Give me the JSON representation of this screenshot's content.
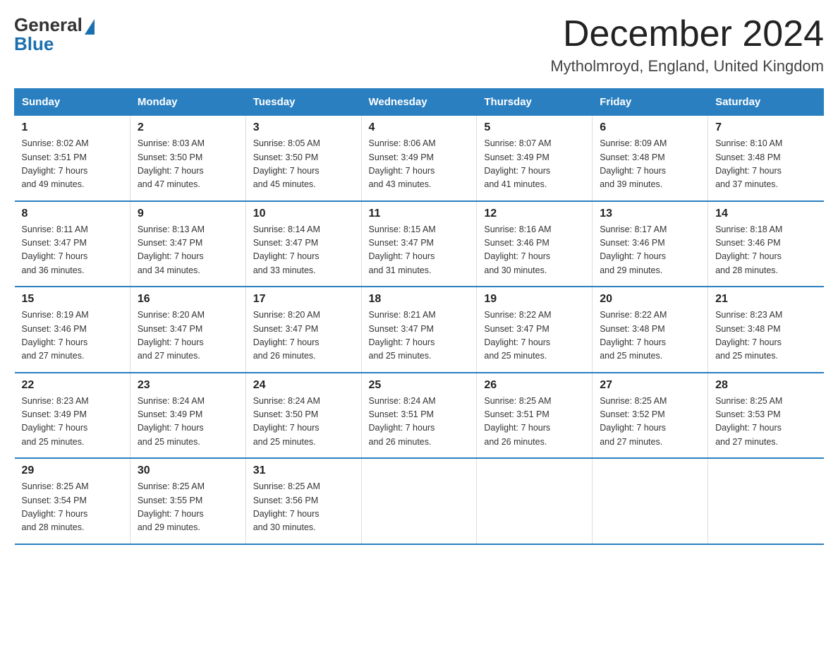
{
  "header": {
    "logo_general": "General",
    "logo_blue": "Blue",
    "month_title": "December 2024",
    "location": "Mytholmroyd, England, United Kingdom"
  },
  "days_of_week": [
    "Sunday",
    "Monday",
    "Tuesday",
    "Wednesday",
    "Thursday",
    "Friday",
    "Saturday"
  ],
  "weeks": [
    [
      {
        "day": "1",
        "sunrise": "8:02 AM",
        "sunset": "3:51 PM",
        "daylight": "7 hours and 49 minutes."
      },
      {
        "day": "2",
        "sunrise": "8:03 AM",
        "sunset": "3:50 PM",
        "daylight": "7 hours and 47 minutes."
      },
      {
        "day": "3",
        "sunrise": "8:05 AM",
        "sunset": "3:50 PM",
        "daylight": "7 hours and 45 minutes."
      },
      {
        "day": "4",
        "sunrise": "8:06 AM",
        "sunset": "3:49 PM",
        "daylight": "7 hours and 43 minutes."
      },
      {
        "day": "5",
        "sunrise": "8:07 AM",
        "sunset": "3:49 PM",
        "daylight": "7 hours and 41 minutes."
      },
      {
        "day": "6",
        "sunrise": "8:09 AM",
        "sunset": "3:48 PM",
        "daylight": "7 hours and 39 minutes."
      },
      {
        "day": "7",
        "sunrise": "8:10 AM",
        "sunset": "3:48 PM",
        "daylight": "7 hours and 37 minutes."
      }
    ],
    [
      {
        "day": "8",
        "sunrise": "8:11 AM",
        "sunset": "3:47 PM",
        "daylight": "7 hours and 36 minutes."
      },
      {
        "day": "9",
        "sunrise": "8:13 AM",
        "sunset": "3:47 PM",
        "daylight": "7 hours and 34 minutes."
      },
      {
        "day": "10",
        "sunrise": "8:14 AM",
        "sunset": "3:47 PM",
        "daylight": "7 hours and 33 minutes."
      },
      {
        "day": "11",
        "sunrise": "8:15 AM",
        "sunset": "3:47 PM",
        "daylight": "7 hours and 31 minutes."
      },
      {
        "day": "12",
        "sunrise": "8:16 AM",
        "sunset": "3:46 PM",
        "daylight": "7 hours and 30 minutes."
      },
      {
        "day": "13",
        "sunrise": "8:17 AM",
        "sunset": "3:46 PM",
        "daylight": "7 hours and 29 minutes."
      },
      {
        "day": "14",
        "sunrise": "8:18 AM",
        "sunset": "3:46 PM",
        "daylight": "7 hours and 28 minutes."
      }
    ],
    [
      {
        "day": "15",
        "sunrise": "8:19 AM",
        "sunset": "3:46 PM",
        "daylight": "7 hours and 27 minutes."
      },
      {
        "day": "16",
        "sunrise": "8:20 AM",
        "sunset": "3:47 PM",
        "daylight": "7 hours and 27 minutes."
      },
      {
        "day": "17",
        "sunrise": "8:20 AM",
        "sunset": "3:47 PM",
        "daylight": "7 hours and 26 minutes."
      },
      {
        "day": "18",
        "sunrise": "8:21 AM",
        "sunset": "3:47 PM",
        "daylight": "7 hours and 25 minutes."
      },
      {
        "day": "19",
        "sunrise": "8:22 AM",
        "sunset": "3:47 PM",
        "daylight": "7 hours and 25 minutes."
      },
      {
        "day": "20",
        "sunrise": "8:22 AM",
        "sunset": "3:48 PM",
        "daylight": "7 hours and 25 minutes."
      },
      {
        "day": "21",
        "sunrise": "8:23 AM",
        "sunset": "3:48 PM",
        "daylight": "7 hours and 25 minutes."
      }
    ],
    [
      {
        "day": "22",
        "sunrise": "8:23 AM",
        "sunset": "3:49 PM",
        "daylight": "7 hours and 25 minutes."
      },
      {
        "day": "23",
        "sunrise": "8:24 AM",
        "sunset": "3:49 PM",
        "daylight": "7 hours and 25 minutes."
      },
      {
        "day": "24",
        "sunrise": "8:24 AM",
        "sunset": "3:50 PM",
        "daylight": "7 hours and 25 minutes."
      },
      {
        "day": "25",
        "sunrise": "8:24 AM",
        "sunset": "3:51 PM",
        "daylight": "7 hours and 26 minutes."
      },
      {
        "day": "26",
        "sunrise": "8:25 AM",
        "sunset": "3:51 PM",
        "daylight": "7 hours and 26 minutes."
      },
      {
        "day": "27",
        "sunrise": "8:25 AM",
        "sunset": "3:52 PM",
        "daylight": "7 hours and 27 minutes."
      },
      {
        "day": "28",
        "sunrise": "8:25 AM",
        "sunset": "3:53 PM",
        "daylight": "7 hours and 27 minutes."
      }
    ],
    [
      {
        "day": "29",
        "sunrise": "8:25 AM",
        "sunset": "3:54 PM",
        "daylight": "7 hours and 28 minutes."
      },
      {
        "day": "30",
        "sunrise": "8:25 AM",
        "sunset": "3:55 PM",
        "daylight": "7 hours and 29 minutes."
      },
      {
        "day": "31",
        "sunrise": "8:25 AM",
        "sunset": "3:56 PM",
        "daylight": "7 hours and 30 minutes."
      },
      null,
      null,
      null,
      null
    ]
  ],
  "labels": {
    "sunrise": "Sunrise:",
    "sunset": "Sunset:",
    "daylight": "Daylight:"
  }
}
